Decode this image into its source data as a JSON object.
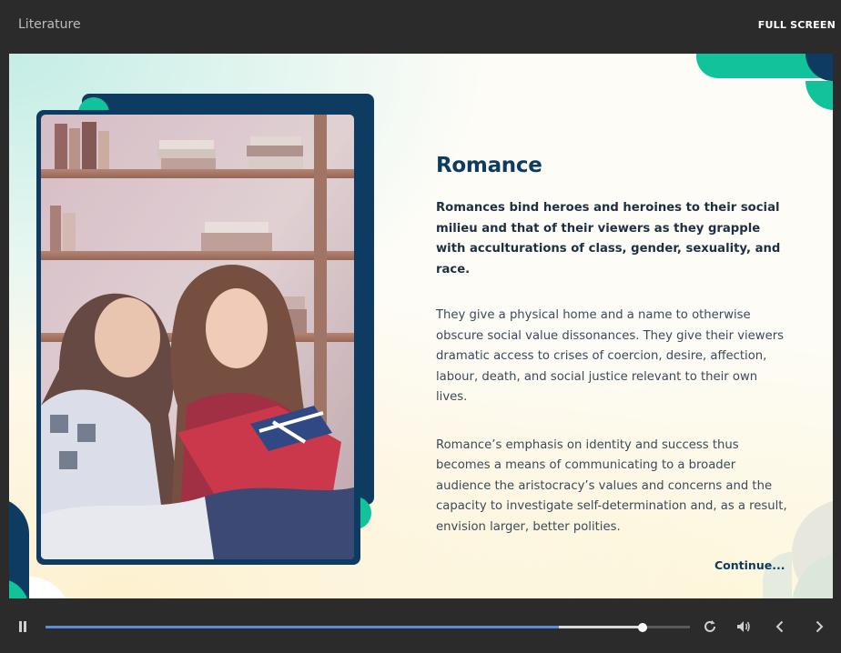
{
  "header": {
    "course_title": "Literature",
    "fullscreen_label": "FULL SCREEN"
  },
  "slide": {
    "heading": "Romance",
    "lead": "Romances bind heroes and heroines to their social milieu and that of their viewers as they grapple with acculturations of class, gender, sexuality, and race.",
    "paragraph_1": "They give a physical home and a name to otherwise obscure social value dissonances. They give their viewers dramatic access to crises of coercion, desire, affection, labour, death, and social justice relevant to their own lives.",
    "paragraph_2": "Romance’s emphasis on identity and success thus becomes a means of communicating to a broader audience the aristocracy’s values and concerns and the capacity to investigate self-determination and, as a result, envision larger, better polities.",
    "continue_label": "Continue..."
  },
  "player": {
    "progress_fraction": 0.926,
    "played_fraction": 0.797
  },
  "icons": {
    "pause": "pause-icon",
    "replay": "replay-icon",
    "volume": "volume-icon",
    "previous": "chevron-left-icon",
    "next": "chevron-right-icon"
  },
  "colors": {
    "navy": "#0d3b62",
    "teal": "#11c39a",
    "progress": "#5b8dd6"
  }
}
